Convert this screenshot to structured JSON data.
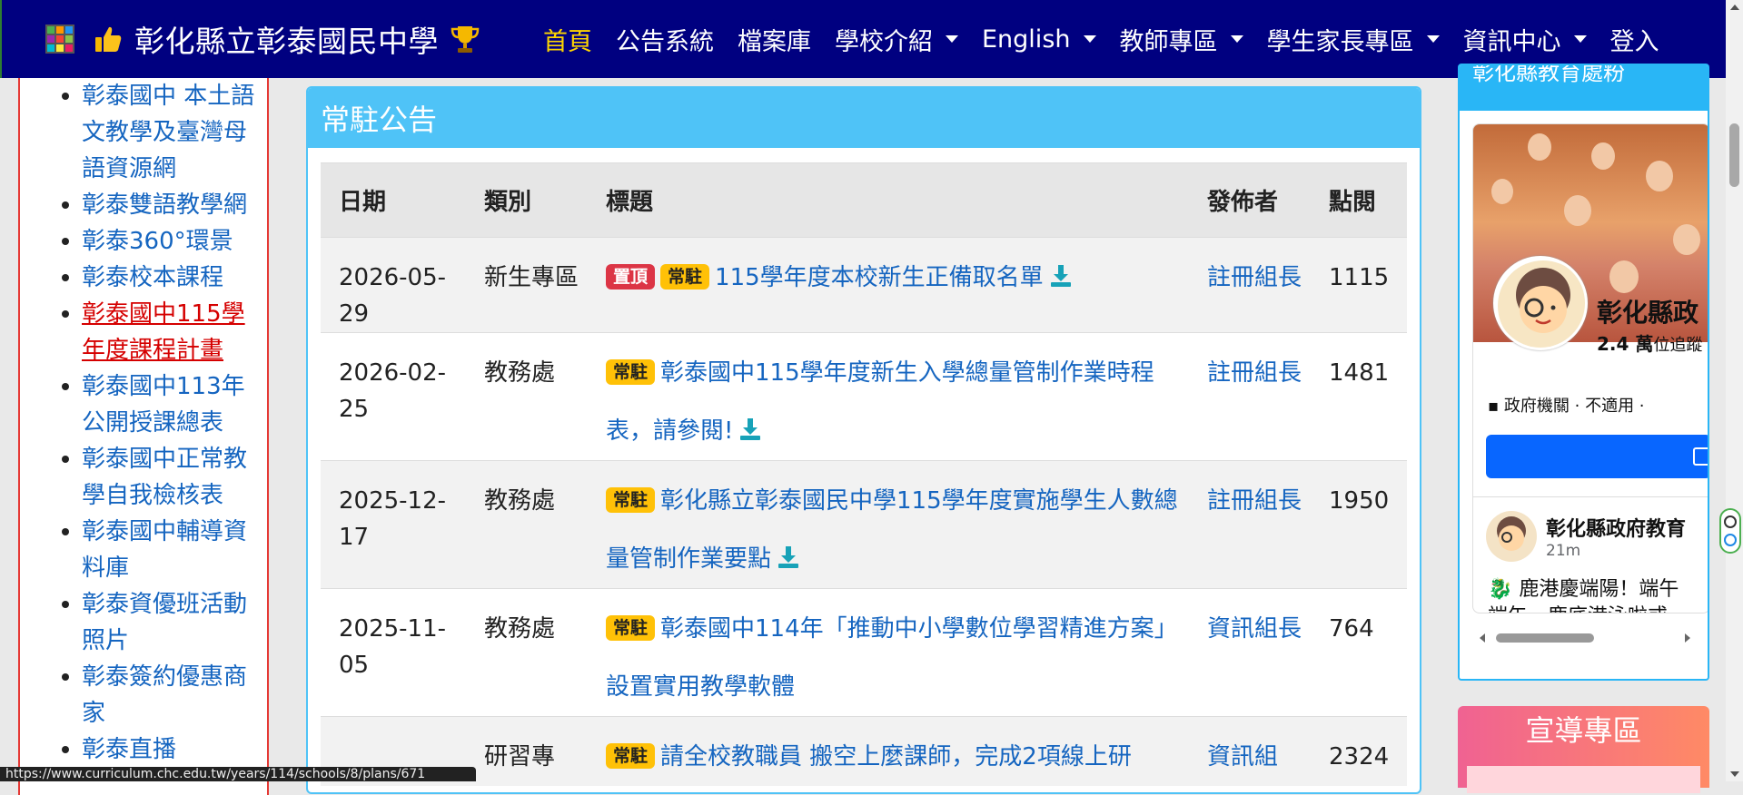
{
  "brand": {
    "title": "彰化縣立彰泰國民中學"
  },
  "nav": {
    "items": [
      {
        "label": "首頁",
        "active": true,
        "dropdown": false
      },
      {
        "label": "公告系統",
        "active": false,
        "dropdown": false
      },
      {
        "label": "檔案庫",
        "active": false,
        "dropdown": false
      },
      {
        "label": "學校介紹",
        "active": false,
        "dropdown": true
      },
      {
        "label": "English",
        "active": false,
        "dropdown": true
      },
      {
        "label": "教師專區",
        "active": false,
        "dropdown": true
      },
      {
        "label": "學生家長專區",
        "active": false,
        "dropdown": true
      },
      {
        "label": "資訊中心",
        "active": false,
        "dropdown": true
      },
      {
        "label": "登入",
        "active": false,
        "dropdown": false
      }
    ]
  },
  "sidebar": {
    "items": [
      {
        "label": "彰泰國中 本土語文教學及臺灣母語資源網",
        "highlight": false
      },
      {
        "label": "彰泰雙語教學網",
        "highlight": false
      },
      {
        "label": "彰泰360°環景",
        "highlight": false
      },
      {
        "label": "彰泰校本課程",
        "highlight": false
      },
      {
        "label": "彰泰國中115學年度課程計畫",
        "highlight": true
      },
      {
        "label": "彰泰國中113年公開授課總表",
        "highlight": false
      },
      {
        "label": "彰泰國中正常教學自我檢核表",
        "highlight": false
      },
      {
        "label": "彰泰國中輔導資料庫",
        "highlight": false
      },
      {
        "label": "彰泰資優班活動照片",
        "highlight": false
      },
      {
        "label": "彰泰簽約優惠商家",
        "highlight": false
      },
      {
        "label": "彰泰直播",
        "highlight": false
      }
    ]
  },
  "announcements": {
    "heading": "常駐公告",
    "columns": [
      "日期",
      "類別",
      "標題",
      "發佈者",
      "點閱"
    ],
    "badges": {
      "pin": "置頂",
      "perm": "常駐"
    },
    "rows": [
      {
        "date": "2026-05-29",
        "category": "新生專區",
        "pinned": true,
        "title": "115學年度本校新生正備取名單",
        "attachment": true,
        "publisher": "註冊組長",
        "views": "1115"
      },
      {
        "date": "2026-02-25",
        "category": "教務處",
        "pinned": false,
        "title": "彰泰國中115學年度新生入學總量管制作業時程表，請參閱!",
        "attachment": true,
        "publisher": "註冊組長",
        "views": "1481"
      },
      {
        "date": "2025-12-17",
        "category": "教務處",
        "pinned": false,
        "title": "彰化縣立彰泰國民中學115學年度實施學生人數總量管制作業要點",
        "attachment": true,
        "publisher": "註冊組長",
        "views": "1950"
      },
      {
        "date": "2025-11-05",
        "category": "教務處",
        "pinned": false,
        "title": "彰泰國中114年「推動中小學數位學習精進方案」 設置實用教學軟體",
        "attachment": false,
        "publisher": "資訊組長",
        "views": "764"
      },
      {
        "date": "",
        "category": "研習專",
        "pinned": false,
        "title": "請全校教職員 搬空上麼課師，完成2項線上研",
        "attachment": false,
        "publisher": "資訊組",
        "views": "2324"
      }
    ]
  },
  "right_panel": {
    "heading": "彰化縣教育處粉",
    "facebook": {
      "page_name": "彰化縣政",
      "followers_count": "2.4 萬",
      "followers_suffix": "位追蹤",
      "meta": "政府機關 · 不適用 ·",
      "post_author": "彰化縣政府教育",
      "post_time": "21m",
      "post_text": "鹿港慶端陽！端午",
      "post_text2": "端午，鹿底港泳啦或"
    }
  },
  "promo": {
    "heading": "宣導專區"
  },
  "status_url": "https://www.curriculum.chc.edu.tw/years/114/schools/8/plans/671"
}
